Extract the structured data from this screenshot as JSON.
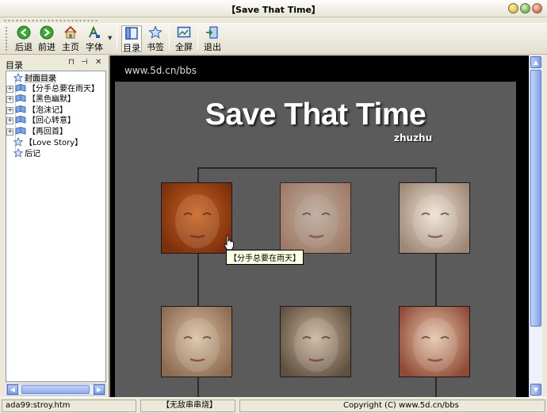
{
  "window": {
    "title": "【Save That Time】"
  },
  "toolbar": {
    "back": "后退",
    "forward": "前进",
    "home": "主页",
    "font": "字体",
    "toc": "目录",
    "bookmark": "书签",
    "fullscreen": "全屏",
    "exit": "退出"
  },
  "sidebar": {
    "title": "目录",
    "pin_glyph": "⊓",
    "autohide_glyph": "⊣",
    "close_glyph": "✕",
    "items": [
      {
        "label": "封面目录",
        "kind": "star",
        "expandable": false,
        "selected": true
      },
      {
        "label": "【分手总要在雨天】",
        "kind": "book",
        "expandable": true
      },
      {
        "label": "【黑色幽默】",
        "kind": "book",
        "expandable": true
      },
      {
        "label": "【泡沫记】",
        "kind": "book",
        "expandable": true
      },
      {
        "label": "【回心转意】",
        "kind": "book",
        "expandable": true
      },
      {
        "label": "【再回首】",
        "kind": "book",
        "expandable": true
      },
      {
        "label": "【Love Story】",
        "kind": "star",
        "expandable": false
      },
      {
        "label": "后记",
        "kind": "star",
        "expandable": false
      }
    ]
  },
  "content": {
    "site_url": "www.5d.cn/bbs",
    "title": "Save That Time",
    "subtitle": "zhuzhu",
    "tooltip": "【分手总要在雨天】",
    "photos": [
      {
        "name": "photo-1",
        "tone": [
          "#c9621d",
          "#7a2e0c"
        ],
        "dim": false
      },
      {
        "name": "photo-2",
        "tone": [
          "#e8cdb8",
          "#b9876a"
        ],
        "dim": true
      },
      {
        "name": "photo-3",
        "tone": [
          "#efe1d2",
          "#9e8775"
        ],
        "dim": false
      },
      {
        "name": "photo-4",
        "tone": [
          "#d9c0a4",
          "#8c6a4f"
        ],
        "dim": false
      },
      {
        "name": "photo-5",
        "tone": [
          "#cbb39a",
          "#5f5040"
        ],
        "dim": false
      },
      {
        "name": "photo-6",
        "tone": [
          "#e6c6ac",
          "#8f4a35"
        ],
        "dim": false
      }
    ]
  },
  "status": {
    "path": "ada99:stroy.htm",
    "section": "【无敌串串烧】",
    "copyright": "Copyright (C) www.5d.cn/bbs"
  }
}
